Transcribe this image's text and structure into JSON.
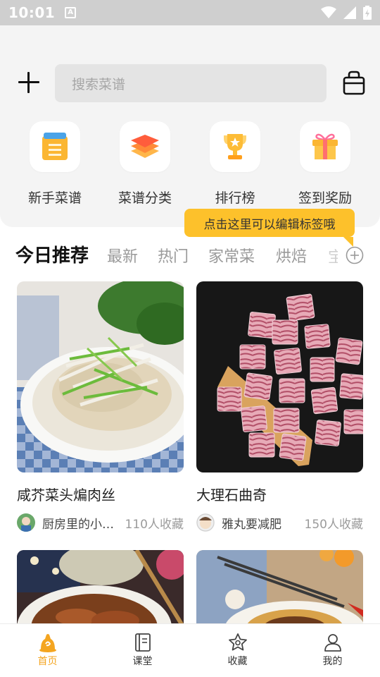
{
  "status_bar": {
    "time": "10:01",
    "indicator": "A"
  },
  "header": {
    "add_icon": "plus-icon",
    "search_placeholder": "搜索菜谱",
    "bag_icon": "shopping-bag-icon"
  },
  "quick_actions": [
    {
      "label": "新手菜谱",
      "icon": "recipe-book-icon",
      "color": "#fbb632"
    },
    {
      "label": "菜谱分类",
      "icon": "layers-icon",
      "color": "#ff6a3d"
    },
    {
      "label": "排行榜",
      "icon": "trophy-icon",
      "color": "#fdbc36"
    },
    {
      "label": "签到奖励",
      "icon": "gift-icon",
      "color": "#fbb632"
    }
  ],
  "tooltip": {
    "text": "点击这里可以编辑标签哦"
  },
  "tabs": [
    {
      "label": "今日推荐",
      "active": true
    },
    {
      "label": "最新",
      "active": false
    },
    {
      "label": "热门",
      "active": false
    },
    {
      "label": "家常菜",
      "active": false
    },
    {
      "label": "烘焙",
      "active": false
    },
    {
      "label": "宝",
      "active": false
    }
  ],
  "recipes": [
    {
      "title": "咸芥菜头煸肉丝",
      "author": "厨房里的小…",
      "favorites": "110人收藏"
    },
    {
      "title": "大理石曲奇",
      "author": "雅丸要减肥",
      "favorites": "150人收藏"
    }
  ],
  "bottom_nav": [
    {
      "label": "首页",
      "icon": "home-icon",
      "active": true
    },
    {
      "label": "课堂",
      "icon": "book-icon",
      "active": false
    },
    {
      "label": "收藏",
      "icon": "star-icon",
      "active": false
    },
    {
      "label": "我的",
      "icon": "user-icon",
      "active": false
    }
  ],
  "colors": {
    "accent": "#f4a520",
    "tooltip": "#fdc12b"
  }
}
